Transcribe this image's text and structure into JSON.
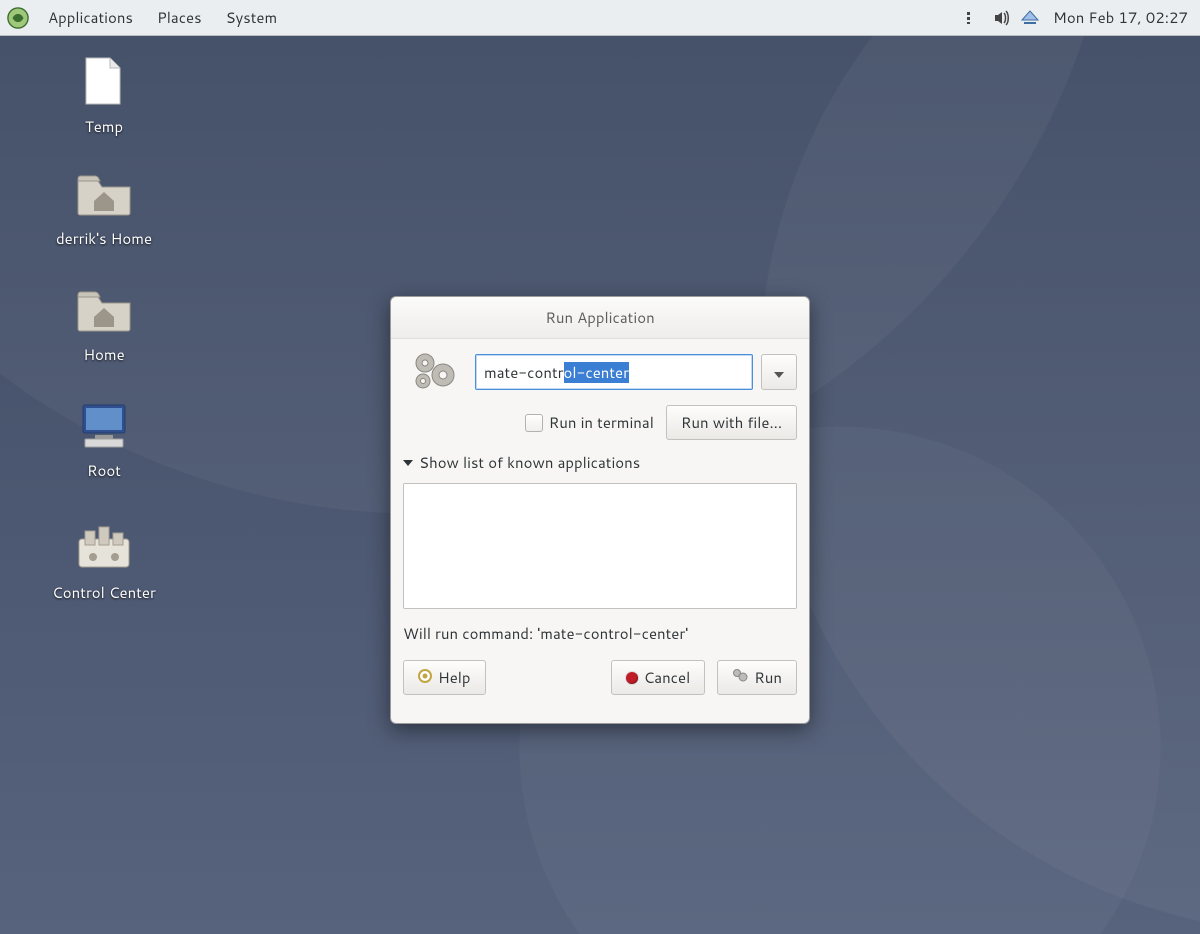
{
  "panel": {
    "menus": {
      "applications": "Applications",
      "places": "Places",
      "system": "System"
    },
    "clock": "Mon Feb 17, 02:27"
  },
  "desktop": {
    "items": [
      {
        "label": "Temp"
      },
      {
        "label": "derrik's Home"
      },
      {
        "label": "Home"
      },
      {
        "label": "Root"
      },
      {
        "label": "Control Center"
      }
    ]
  },
  "dialog": {
    "title": "Run Application",
    "command_value_prefix": "mate-contr",
    "command_value_selected": "ol-center",
    "run_in_terminal_label": "Run in terminal",
    "run_with_file_label": "Run with file...",
    "disclosure_label": "Show list of known applications",
    "will_run_label": "Will run command: 'mate-control-center'",
    "buttons": {
      "help": "Help",
      "cancel": "Cancel",
      "run": "Run"
    }
  }
}
